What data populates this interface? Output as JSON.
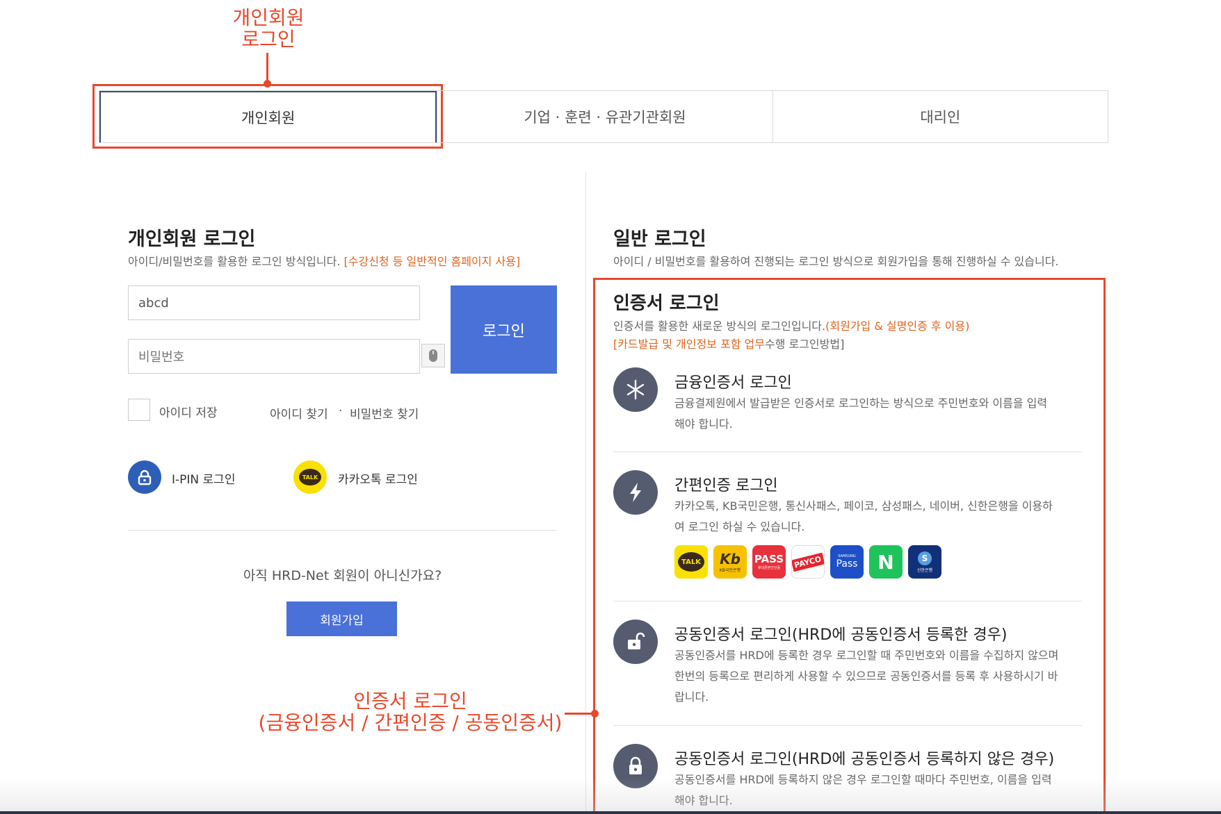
{
  "annotations": {
    "personal_login": [
      "개인회원",
      "로그인"
    ],
    "cert_login": [
      "인증서 로그인",
      "(금융인증서 / 간편인증 / 공동인증서)"
    ]
  },
  "tabs": [
    {
      "label": "개인회원",
      "active": true
    },
    {
      "label": "기업 · 훈련 · 유관기관회원",
      "active": false
    },
    {
      "label": "대리인",
      "active": false
    }
  ],
  "left": {
    "title": "개인회원 로그인",
    "desc": "아이디/비밀번호를 활용한 로그인 방식입니다.",
    "desc_highlight": "[수강신청 등 일반적인 홈페이지 사용]",
    "id_value": "abcd",
    "pw_placeholder": "비밀번호",
    "login_label": "로그인",
    "save_id": "아이디 저장",
    "find_id": "아이디 찾기",
    "sep": "·",
    "find_pw": "비밀번호 찾기",
    "ipin": "I-PIN 로그인",
    "kakao": "카카오톡 로그인",
    "kakao_icon_text": "TALK",
    "not_member": "아직 HRD-Net 회원이 아니신가요?",
    "join": "회원가입"
  },
  "right": {
    "general_title": "일반 로그인",
    "general_desc": "아이디 / 비밀번호를 활용하여 진행되는 로그인 방식으로 회원가입을 통해 진행하실 수 있습니다.",
    "cert_title": "인증서 로그인",
    "cert_desc": "인증서를 활용한 새로운 방식의 로그인입니다.",
    "cert_desc_hl": "(회원가입 & 실명인증 후 이용)",
    "cert_desc2_hl": "[카드발급 및 개인정보 포함 업무",
    "cert_desc2": "수행 로그인방법]",
    "methods": [
      {
        "title": "금융인증서 로그인",
        "desc1": "금융결제원에서 발급받은 인증서로 로그인하는 방식으로 주민번호와 이름을 입력",
        "desc2": "해야 합니다.",
        "desc3": ""
      },
      {
        "title": "간편인증 로그인",
        "desc1": "카카오톡, KB국민은행, 통신사패스, 페이코, 삼성패스, 네이버, 신한은행을 이용하",
        "desc2": "여 로그인 하실 수 있습니다.",
        "desc3": ""
      },
      {
        "title": "공동인증서 로그인(HRD에 공동인증서 등록한 경우)",
        "desc1": "공동인증서를 HRD에 등록한 경우 로그인할 때 주민번호와 이름을 수집하지 않으며",
        "desc2": "한번의 등록으로 편리하게 사용할 수 있으므로 공동인증서를 등록 후 사용하시기 바",
        "desc3": "랍니다."
      },
      {
        "title": "공동인증서 로그인(HRD에 공동인증서 등록하지 않은 경우)",
        "desc1": "공동인증서를 HRD에 등록하지 않은 경우 로그인할 때마다 주민번호, 이름을 입력",
        "desc2": "해야 합니다.",
        "desc3": ""
      }
    ],
    "apps": [
      {
        "name": "kakao",
        "text": "TALK",
        "sub": ""
      },
      {
        "name": "kb",
        "text": "Kb",
        "sub": "KB국민은행"
      },
      {
        "name": "pass",
        "text": "PASS",
        "sub": "휴대폰본인인증"
      },
      {
        "name": "payco",
        "text": "PAYCO",
        "sub": ""
      },
      {
        "name": "samsung-pass",
        "text": "Pass",
        "sub": "SAMSUNG"
      },
      {
        "name": "naver",
        "text": "N",
        "sub": ""
      },
      {
        "name": "shinhan",
        "text": "S",
        "sub": "신한은행"
      }
    ]
  },
  "colors": {
    "accent": "#4a71d8",
    "annotation": "#e8482c",
    "highlight": "#e0631e"
  }
}
